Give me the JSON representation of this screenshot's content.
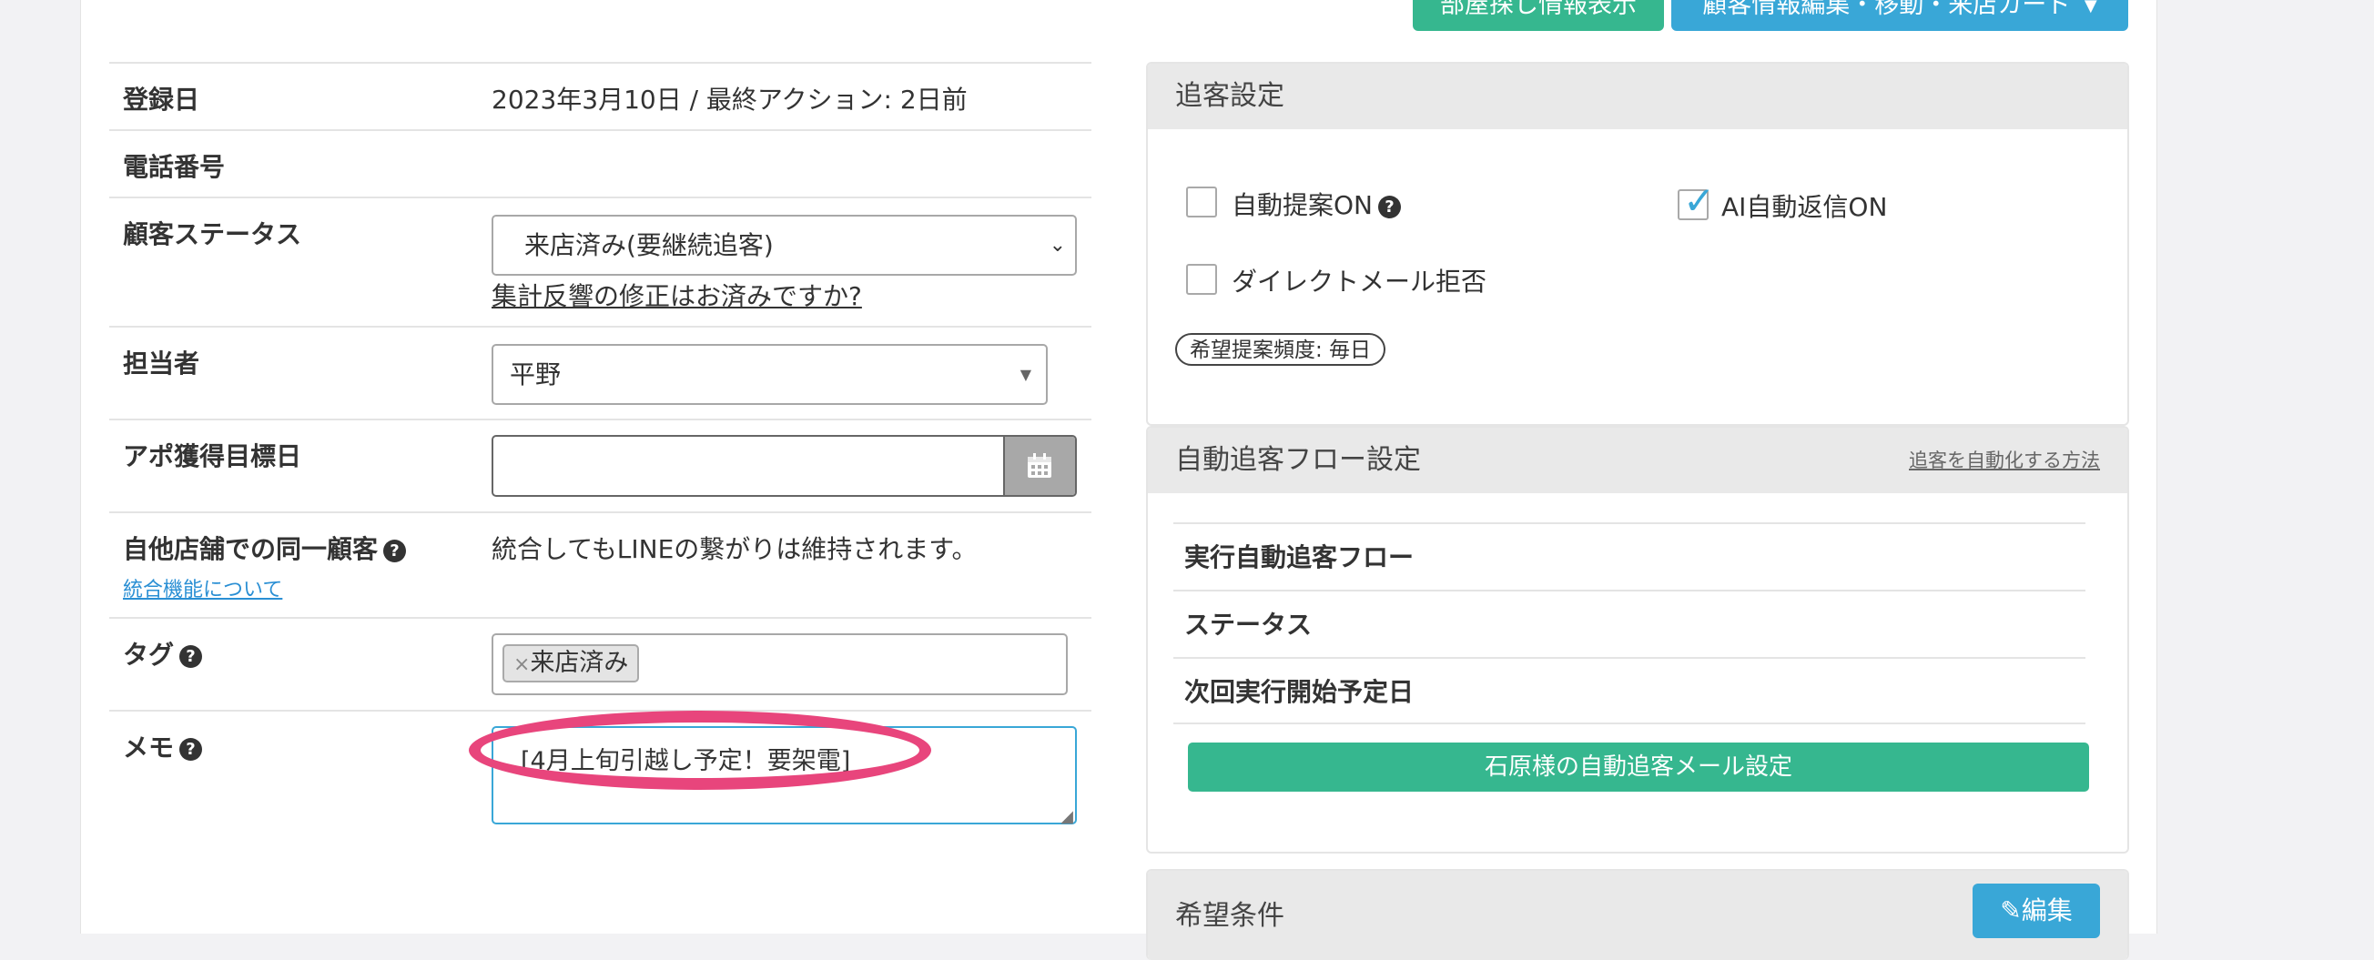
{
  "top_buttons": {
    "room_search": "部屋探し情報表示",
    "customer_edit": "顧客情報編集・移動・来店カード"
  },
  "customer": {
    "registration": {
      "label": "登録日",
      "value": "2023年3月10日 / 最終アクション: 2日前"
    },
    "phone": {
      "label": "電話番号",
      "value": ""
    },
    "status": {
      "label": "顧客ステータス",
      "selected": "来店済み(要継続追客)",
      "link": "集計反響の修正はお済みですか?"
    },
    "assignee": {
      "label": "担当者",
      "selected": "平野"
    },
    "appointment_target": {
      "label": "アポ獲得目標日",
      "value": ""
    },
    "same_customer": {
      "label": "自他店舗での同一顧客",
      "link": "統合機能について",
      "value": "統合してもLINEの繋がりは維持されます。"
    },
    "tags": {
      "label": "タグ",
      "items": [
        "来店済み"
      ],
      "remove_symbol": "×"
    },
    "memo": {
      "label": "メモ",
      "value": "[4月上旬引越し予定！要架電]"
    }
  },
  "follow_settings": {
    "title": "追客設定",
    "auto_proposal": {
      "label": "自動提案ON",
      "checked": false
    },
    "ai_reply": {
      "label": "AI自動返信ON",
      "checked": true
    },
    "direct_mail_reject": {
      "label": "ダイレクトメール拒否",
      "checked": false
    },
    "frequency_pill": "希望提案頻度: 毎日"
  },
  "auto_flow": {
    "title": "自動追客フロー設定",
    "how_to_link": "追客を自動化する方法",
    "rows": [
      "実行自動追客フロー",
      "ステータス",
      "次回実行開始予定日"
    ],
    "mail_button": "石原様の自動追客メール設定"
  },
  "preferences": {
    "title": "希望条件",
    "edit_button": "編集"
  },
  "colors": {
    "green": "#36b78f",
    "blue": "#39a7d7",
    "annotation": "#e8457c"
  },
  "icons": {
    "help": "question-circle-icon",
    "calendar": "calendar-icon",
    "pencil": "pencil-icon",
    "caret": "caret-down-icon",
    "check": "check-icon"
  }
}
